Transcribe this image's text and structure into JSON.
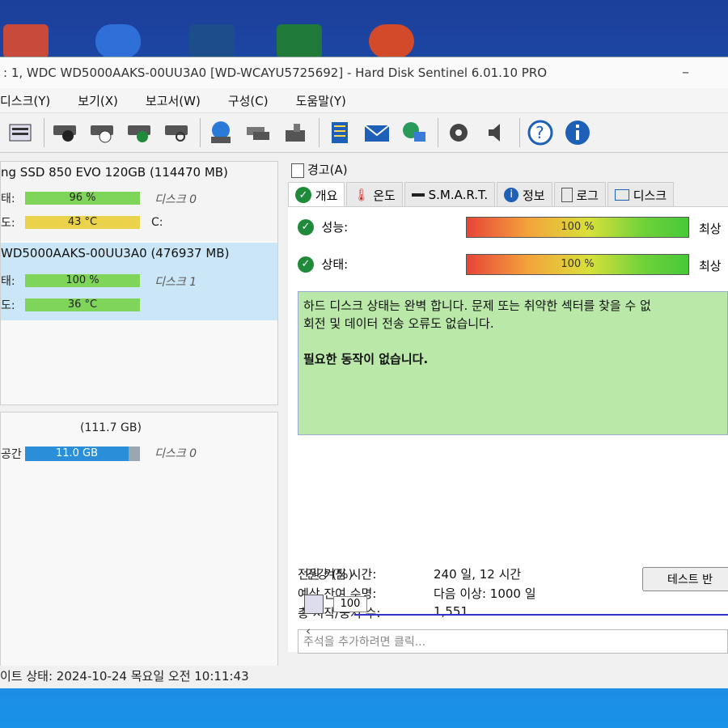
{
  "window": {
    "title": ": 1, WDC WD5000AAKS-00UU3A0 [WD-WCAYU5725692]  -  Hard Disk Sentinel 6.01.10 PRO"
  },
  "menu": [
    "디스크(Y)",
    "보기(X)",
    "보고서(W)",
    "구성(C)",
    "도움말(Y)"
  ],
  "toolbar_icons": [
    "list-icon",
    "disk-icon",
    "disk-clock-icon",
    "disk-check-icon",
    "disk-search-icon",
    "globe-disk-icon",
    "disk-swap-icon",
    "disk-download-icon",
    "notepad-icon",
    "mail-icon",
    "network-icon",
    "gear-icon",
    "speaker-icon",
    "help-icon",
    "info-icon"
  ],
  "disks": [
    {
      "name": "ng SSD 850 EVO 120GB",
      "size": "(114470 MB)",
      "health_label": "태:",
      "health": "96 %",
      "health_value": 96,
      "disk_no": "디스크 0",
      "temp_label": "도:",
      "temp": "43 °C",
      "drive": "C:"
    },
    {
      "name": "WD5000AAKS-00UU3A0",
      "size": "(476937 MB)",
      "health_label": "태:",
      "health": "100 %",
      "health_value": 100,
      "disk_no": "디스크 1",
      "temp_label": "도:",
      "temp": "36 °C"
    }
  ],
  "volume": {
    "size": "(111.7 GB)",
    "label": "공간",
    "free": "11.0 GB",
    "disk_no": "디스크 0"
  },
  "alert_tab": "경고(A)",
  "tabs": [
    "개요",
    "온도",
    "S.M.A.R.T.",
    "정보",
    "로그",
    "디스크"
  ],
  "perf": {
    "label": "성능:",
    "value": "100 %",
    "percent": 100,
    "rating": "최상"
  },
  "state": {
    "label": "상태:",
    "value": "100 %",
    "percent": 100,
    "rating": "최상"
  },
  "message": {
    "line1": "하드 디스크 상태는 완벽 합니다. 문제 또는 취약한 섹터를 찾을 수 없",
    "line2": "회전 및 데이터 전송 오류도 없습니다.",
    "action": "필요한 동작이 없습니다."
  },
  "info": {
    "power_on_label": "전원 켜짐 시간:",
    "power_on": "240 일, 12 시간",
    "remaining_label": "예상 잔여 수명:",
    "remaining": "다음 이상: 1000 일",
    "startstop_label": "총 시작/중지 수:",
    "startstop": "1,551"
  },
  "test_button": "테스트 반",
  "note_placeholder": "주석을 추가하려면 클릭...",
  "health_chart": {
    "label": "건강 (%)",
    "value_label": "100",
    "value": 100
  },
  "status_bar": "이트 상태: 2024-10-24 목요일 오전 10:11:43"
}
